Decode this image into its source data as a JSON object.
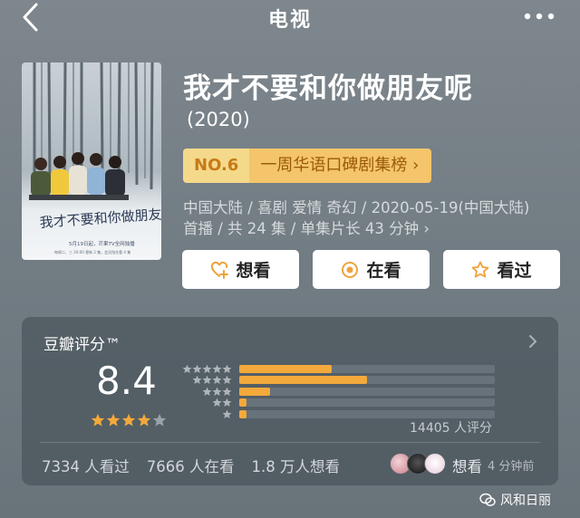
{
  "header": {
    "title": "电视"
  },
  "show": {
    "title": "我才不要和你做朋友呢",
    "year": "(2020)",
    "rank_no": "NO.6",
    "rank_list": "一周华语口碑剧集榜 ›",
    "meta_line1": "中国大陆 / 喜剧 爱情 奇幻 / 2020-05-19(中国大陆)",
    "meta_line2": "首播 / 共 24 集 / 单集片长 43 分钟 ›",
    "poster_title": "我才不要和你做朋友呢",
    "poster_caption1": "5月19日起，芒果TV全网独播",
    "poster_caption2": "每周二、三 20:00 更新 2 集，会员抢先看 4 集"
  },
  "actions": [
    {
      "label": "想看",
      "icon": "heart-plus-icon"
    },
    {
      "label": "在看",
      "icon": "circle-dot-icon"
    },
    {
      "label": "看过",
      "icon": "star-outline-icon"
    }
  ],
  "rating": {
    "title": "豆瓣评分™",
    "score": "8.4",
    "stars_filled": 4,
    "stars_total": 5,
    "distribution": [
      {
        "stars": 5,
        "fraction": 0.36
      },
      {
        "stars": 4,
        "fraction": 0.5
      },
      {
        "stars": 3,
        "fraction": 0.12
      },
      {
        "stars": 2,
        "fraction": 0.03
      },
      {
        "stars": 1,
        "fraction": 0.03
      }
    ],
    "count": "14405 人评分"
  },
  "stats": {
    "watched": "7334 人看过",
    "watching": "7666 人在看",
    "want": "1.8 万人想看"
  },
  "activity": {
    "label": "想看",
    "time": "4 分钟前"
  },
  "watermark": {
    "text": "风和日丽"
  },
  "colors": {
    "accent": "#f3a93b",
    "badge_bg": "#f4c56a",
    "card_bg": "#4a545c"
  }
}
